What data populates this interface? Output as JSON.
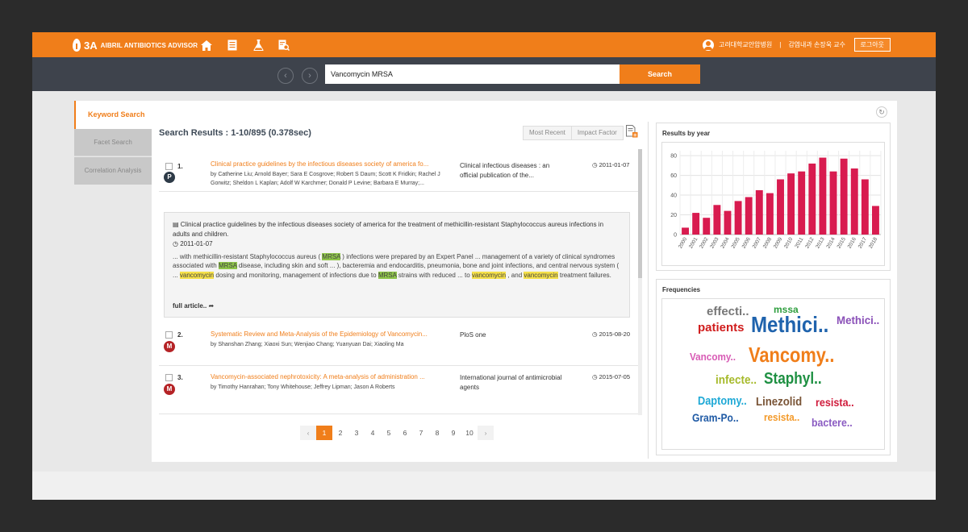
{
  "header": {
    "logo_mark": "3A",
    "app_name": "AIBRIL ANTIBIOTICS ADVISOR",
    "nav_icons": [
      "home-icon",
      "document-icon",
      "flask-icon",
      "search-document-icon"
    ],
    "hospital": "고려대학교안암병원",
    "separator": "|",
    "user": "감염내과 손장욱 교수",
    "logout_label": "로그아웃"
  },
  "search": {
    "query": "Vancomycin MRSA",
    "button_label": "Search",
    "back_icon": "chevron-left-icon",
    "forward_icon": "chevron-right-icon"
  },
  "tabs": [
    {
      "label": "Keyword Search"
    },
    {
      "label": "Facet Search"
    },
    {
      "label": "Correlation Analysis"
    }
  ],
  "results_header": {
    "title": "Search Results : 1-10/895 (0.378sec)",
    "sort_most_recent": "Most Recent",
    "sort_impact_factor": "Impact Factor"
  },
  "results": [
    {
      "num": "1.",
      "badge": "P",
      "title": "Clinical practice guidelines by the infectious diseases society of america fo...",
      "authors": "by Catherine Liu; Arnold Bayer; Sara E Cosgrove; Robert S Daum; Scott K Fridkin; Rachel J Gorwitz; Sheldon L Kaplan; Adolf W Karchmer; Donald P Levine; Barbara E Murray;...",
      "journal": "Clinical infectious diseases : an official publication of the...",
      "date": "2011-01-07"
    },
    {
      "num": "2.",
      "badge": "M",
      "title": "Systematic Review and Meta-Analysis of the Epidemiology of Vancomycin...",
      "authors": "by Shanshan Zhang; Xiaoxi Sun; Wenjiao Chang; Yuanyuan Dai; Xiaoling Ma",
      "journal": "PloS one",
      "date": "2015-08-20"
    },
    {
      "num": "3.",
      "badge": "M",
      "title": "Vancomycin-associated nephrotoxicity: A meta-analysis of administration ...",
      "authors": "by Timothy Hanrahan; Tony Whitehouse; Jeffrey Lipman; Jason A Roberts",
      "journal": "International journal of antimicrobial agents",
      "date": "2015-07-05"
    }
  ],
  "detail": {
    "title": "Clinical practice guidelines by the infectious diseases society of america for the treatment of methicillin-resistant Staphylococcus aureus infections in adults and children.",
    "date": "2011-01-07",
    "snippet": [
      {
        "t": "... with methicillin-resistant Staphylococcus aureus ( "
      },
      {
        "t": "MRSA",
        "hl": "g"
      },
      {
        "t": " ) infections were prepared by an Expert Panel ... management of a variety of clinical syndromes associated with "
      },
      {
        "t": "MRSA",
        "hl": "g"
      },
      {
        "t": " disease, including skin and soft ... ), bacteremia and endocarditis, pneumonia, bone and joint infections, and central nervous system ( ... "
      },
      {
        "t": "vancomycin",
        "hl": "y"
      },
      {
        "t": " dosing and monitoring, management of infections due to "
      },
      {
        "t": "MRSA",
        "hl": "g"
      },
      {
        "t": " strains with reduced ... to "
      },
      {
        "t": "vancomycin",
        "hl": "y"
      },
      {
        "t": " , and "
      },
      {
        "t": "vancomycin",
        "hl": "y"
      },
      {
        "t": " treatment failures."
      }
    ],
    "full_article_label": "full article.."
  },
  "pagination": {
    "prev": "‹",
    "next": "›",
    "pages": [
      "1",
      "2",
      "3",
      "4",
      "5",
      "6",
      "7",
      "8",
      "9",
      "10"
    ],
    "current": "1"
  },
  "year_panel": {
    "title": "Results by year"
  },
  "chart_data": {
    "type": "bar",
    "title": "Results by year",
    "categories": [
      "2000",
      "2001",
      "2002",
      "2003",
      "2004",
      "2005",
      "2006",
      "2007",
      "2008",
      "2009",
      "2010",
      "2011",
      "2012",
      "2013",
      "2014",
      "2015",
      "2016",
      "2017",
      "2018"
    ],
    "values": [
      7,
      22,
      17,
      30,
      24,
      34,
      38,
      45,
      42,
      56,
      62,
      64,
      72,
      78,
      64,
      77,
      67,
      56,
      29
    ],
    "yticks": [
      0,
      20,
      40,
      60,
      80
    ],
    "ylim": [
      0,
      85
    ],
    "color": "#d81b4f",
    "grid": true
  },
  "freq_panel": {
    "title": "Frequencies",
    "words": [
      {
        "text": "effecti..",
        "color": "#777777"
      },
      {
        "text": "mssa",
        "color": "#2e9e3e"
      },
      {
        "text": "patients",
        "color": "#d01c1c"
      },
      {
        "text": "Methici..",
        "color": "#1f63ad"
      },
      {
        "text": "Methici..",
        "color": "#8a50b8"
      },
      {
        "text": "Vancomy..",
        "color": "#d85bb5"
      },
      {
        "text": "Vancomy..",
        "color": "#f07e1a"
      },
      {
        "text": "infecte..",
        "color": "#a6ba2a"
      },
      {
        "text": "Staphyl..",
        "color": "#1e9042"
      },
      {
        "text": "Daptomy..",
        "color": "#1fa9d6"
      },
      {
        "text": "Linezolid",
        "color": "#7a5537"
      },
      {
        "text": "resista..",
        "color": "#d01c3c"
      },
      {
        "text": "Gram-Po..",
        "color": "#1f5aa5"
      },
      {
        "text": "resista..",
        "color": "#f39a2a"
      },
      {
        "text": "bactere..",
        "color": "#8a5bc2"
      }
    ]
  },
  "colors": {
    "accent": "#f07e1a",
    "dark_bar": "#3e434c",
    "bar": "#d81b4f"
  }
}
